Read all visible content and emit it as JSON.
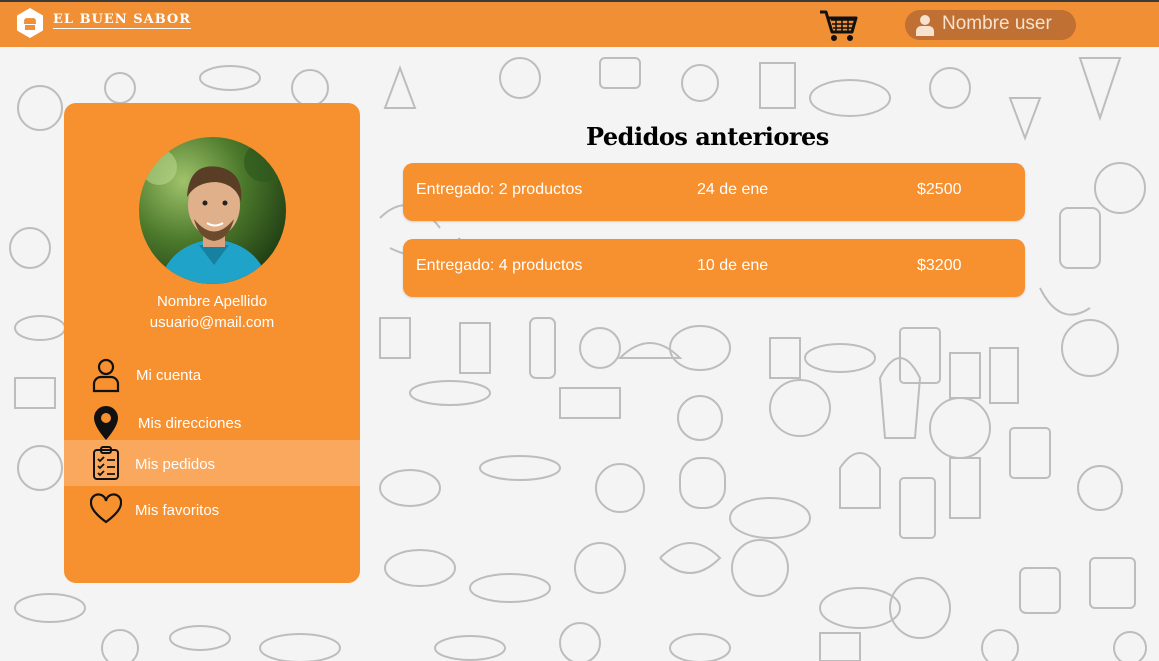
{
  "header": {
    "brand": "EL BUEN SABOR",
    "logo_icon": "chef-hat-icon",
    "cart_icon": "shopping-cart-icon",
    "user_icon": "user-icon",
    "user_name": "Nombre user"
  },
  "profile": {
    "name": "Nombre Apellido",
    "email": "usuario@mail.com"
  },
  "nav": {
    "items": [
      {
        "label": "Mi cuenta",
        "icon": "user-outline-icon"
      },
      {
        "label": "Mis direcciones",
        "icon": "location-pin-icon"
      },
      {
        "label": "Mis pedidos",
        "icon": "clipboard-checklist-icon",
        "active": true
      },
      {
        "label": "Mis favoritos",
        "icon": "heart-icon"
      }
    ]
  },
  "orders": {
    "title": "Pedidos anteriores",
    "items": [
      {
        "status": "Entregado: 2 productos",
        "date": "24 de ene",
        "total": "$2500"
      },
      {
        "status": "Entregado: 4 productos",
        "date": "10 de ene",
        "total": "$3200"
      }
    ]
  },
  "colors": {
    "accent": "#f18f35",
    "panel": "#f7902e",
    "active_item": "#faa85e",
    "user_pill": "#c07033"
  }
}
